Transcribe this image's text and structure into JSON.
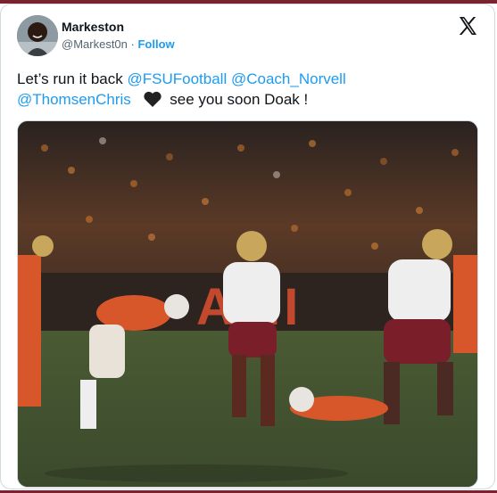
{
  "author": {
    "display_name": "Markeston",
    "handle": "@Markest0n",
    "separator": "·",
    "follow_label": "Follow"
  },
  "tweet": {
    "text_intro": "Let’s run it back",
    "mentions": [
      "@FSUFootball",
      "@Coach_Norvell",
      "@ThomsenChris"
    ],
    "text_outro": "see you soon Doak !",
    "emoji": "black-heart"
  },
  "media": {
    "description": "Football game action photo"
  },
  "colors": {
    "accent": "#1d9bf0",
    "text": "#0f1419",
    "muted": "#536471",
    "strip": "#7a2230"
  },
  "icons": {
    "logo": "x-logo-icon",
    "heart": "black-heart-icon"
  }
}
